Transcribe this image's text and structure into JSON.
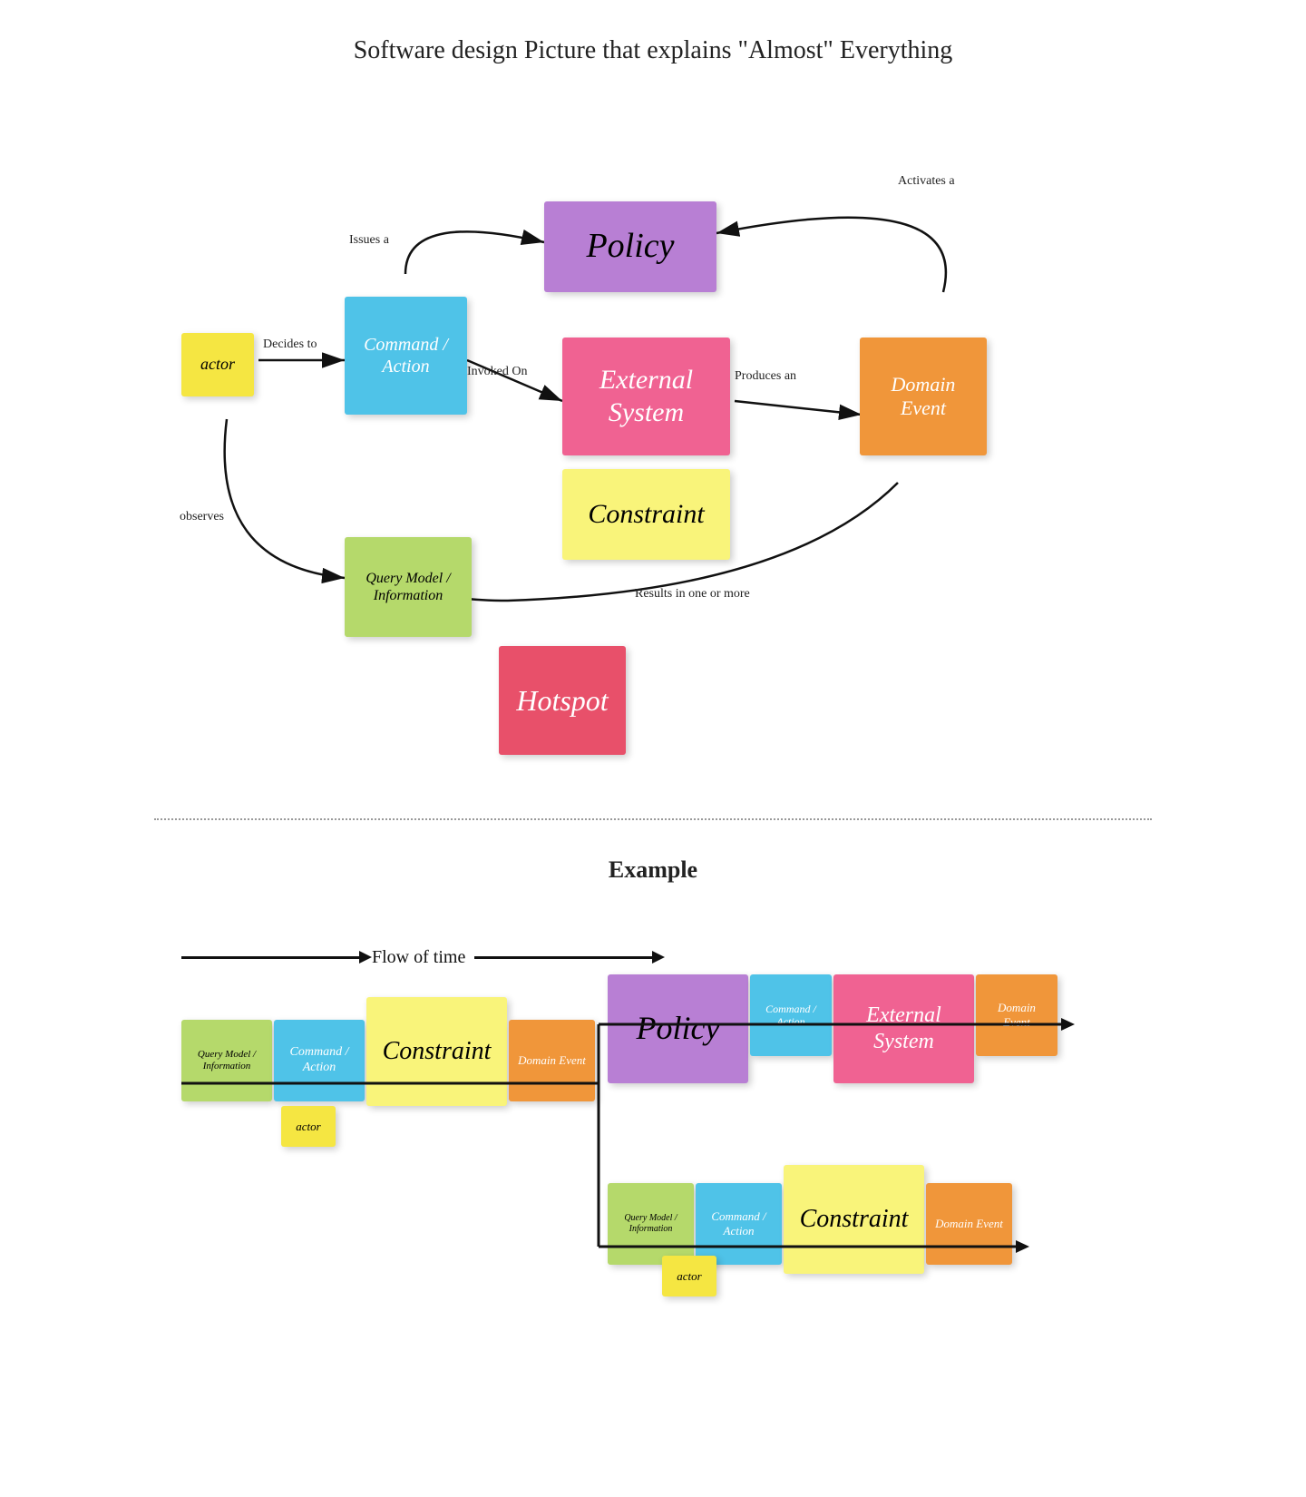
{
  "title": "Software design Picture that explains \"Almost\" Everything",
  "example_label": "Example",
  "flow_of_time": "Flow of time",
  "nodes": {
    "policy": "Policy",
    "command_action": "Command\n/ Action",
    "external_system": "External\nSystem",
    "constraint": "Constraint",
    "domain_event": "Domain\nEvent",
    "actor": "actor",
    "query_model": "Query Model\n/ Information",
    "hotspot": "Hotspot"
  },
  "arrows": {
    "decides_to": "Decides to",
    "issues_a": "Issues a",
    "invoked_on": "Invoked On",
    "produces_an": "Produces an",
    "activates_a": "Activates a",
    "results_in": "Results in one or more",
    "observes": "observes"
  }
}
